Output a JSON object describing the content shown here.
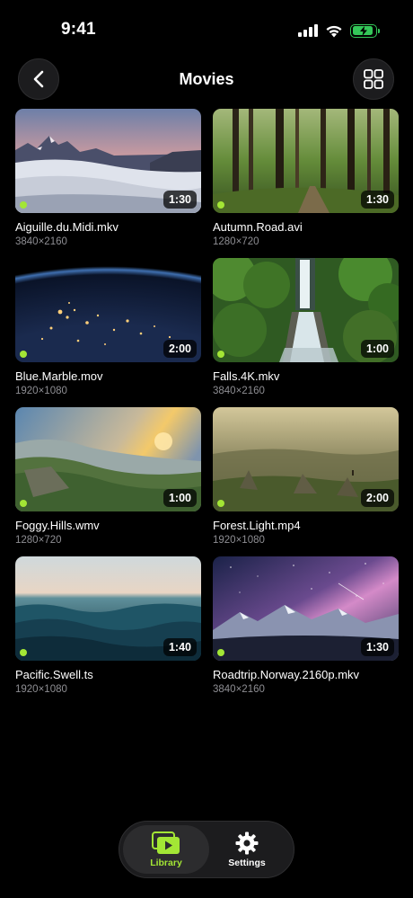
{
  "status": {
    "time": "9:41"
  },
  "header": {
    "title": "Movies"
  },
  "theme": {
    "accent": "#a3e635",
    "background": "#000000",
    "battery": "#34c759"
  },
  "icons": {
    "back": "chevron-left-icon",
    "view": "grid-icon",
    "library": "play-stack-icon",
    "settings": "gear-icon"
  },
  "videos": [
    {
      "name": "Aiguille.du.Midi.mkv",
      "resolution": "3840×2160",
      "duration": "1:30",
      "scene": "mountains-clouds"
    },
    {
      "name": "Autumn.Road.avi",
      "resolution": "1280×720",
      "duration": "1:30",
      "scene": "forest"
    },
    {
      "name": "Blue.Marble.mov",
      "resolution": "1920×1080",
      "duration": "2:00",
      "scene": "earth-night"
    },
    {
      "name": "Falls.4K.mkv",
      "resolution": "3840×2160",
      "duration": "1:00",
      "scene": "waterfall"
    },
    {
      "name": "Foggy.Hills.wmv",
      "resolution": "1280×720",
      "duration": "1:00",
      "scene": "foggy-hills"
    },
    {
      "name": "Forest.Light.mp4",
      "resolution": "1920×1080",
      "duration": "2:00",
      "scene": "misty-valley"
    },
    {
      "name": "Pacific.Swell.ts",
      "resolution": "1920×1080",
      "duration": "1:40",
      "scene": "ocean"
    },
    {
      "name": "Roadtrip.Norway.2160p.mkv",
      "resolution": "3840×2160",
      "duration": "1:30",
      "scene": "milky-way"
    }
  ],
  "tabbar": {
    "tabs": [
      {
        "label": "Library",
        "active": true
      },
      {
        "label": "Settings",
        "active": false
      }
    ]
  }
}
